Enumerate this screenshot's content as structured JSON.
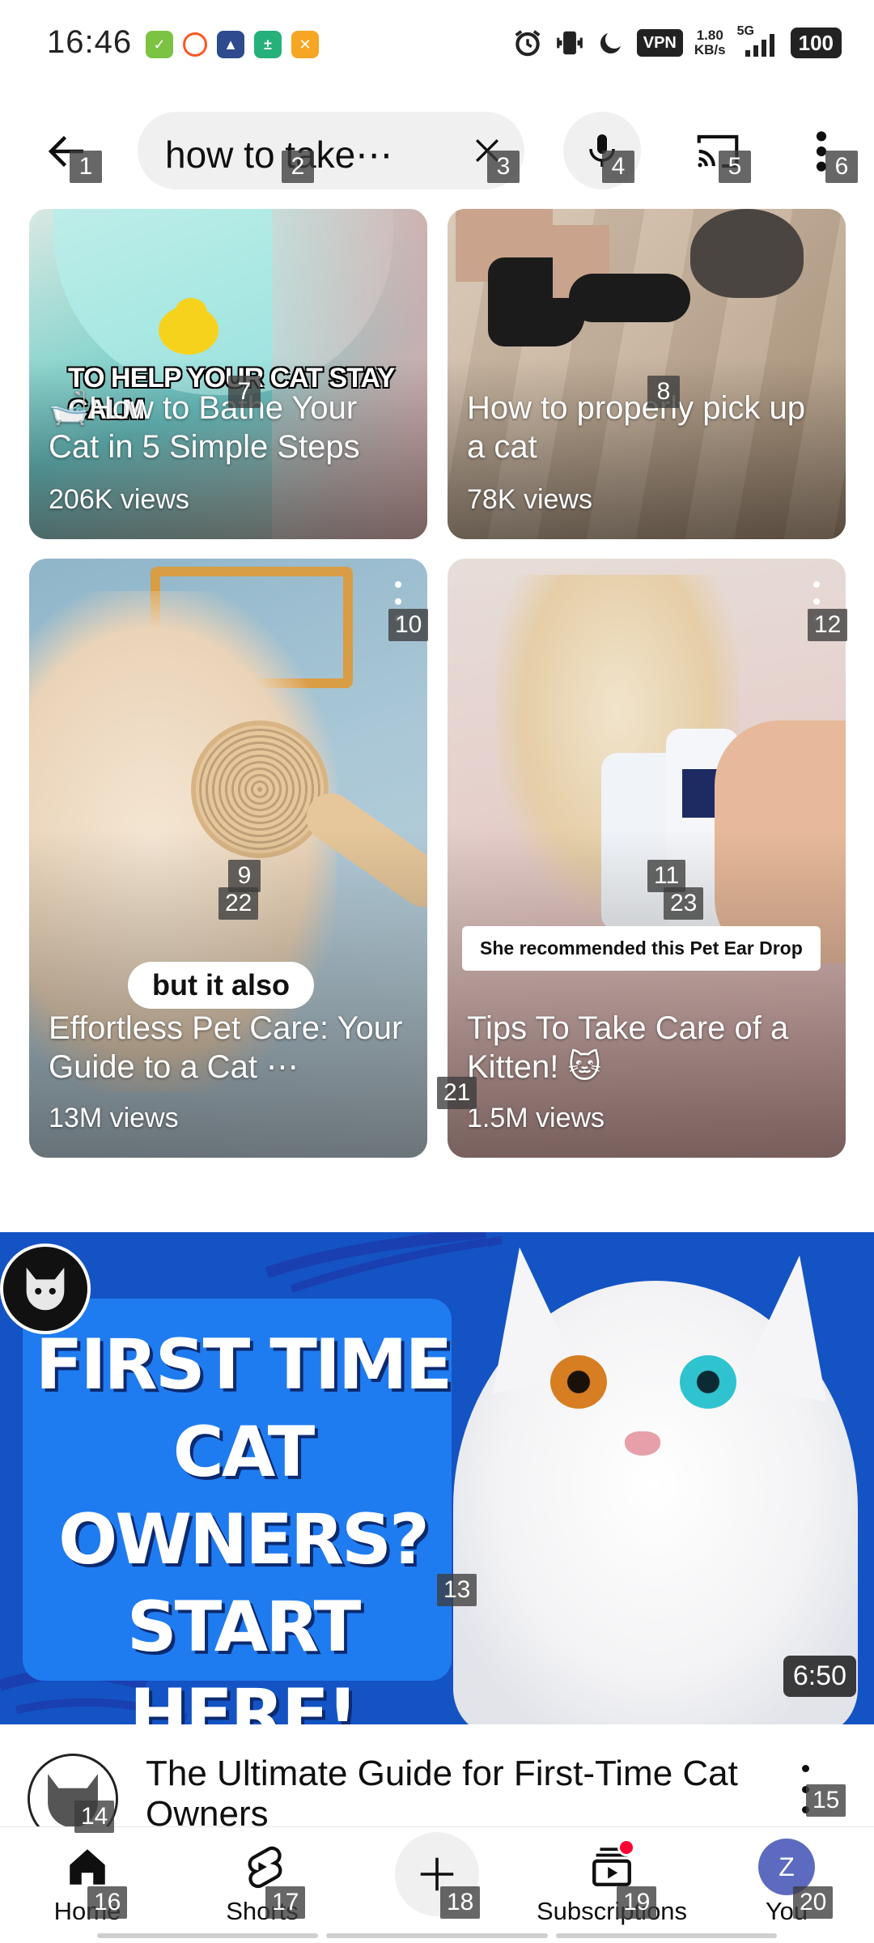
{
  "status_bar": {
    "time": "16:46",
    "vpn_label": "VPN",
    "net_speed_value": "1.80",
    "net_speed_unit": "KB/s",
    "network": "5G",
    "battery": "100"
  },
  "search": {
    "query": "how to take⋯"
  },
  "shorts": [
    {
      "caption_overlay": "TO HELP YOUR CAT STAY CALM",
      "title": "🛁How to Bathe Your Cat in 5 Simple Steps",
      "views": "206K views"
    },
    {
      "title": "How to properly pick up a cat",
      "views": "78K views"
    },
    {
      "caption_pill": "but it also",
      "title": "Effortless Pet Care: Your Guide to a Cat ⋯",
      "views": "13M views"
    },
    {
      "caption_box": "She recommended this Pet Ear Drop",
      "title": "Tips To Take Care of a Kitten! 🐱",
      "views": "1.5M views"
    }
  ],
  "video": {
    "thumbnail_text": [
      "FIRST TIME",
      "CAT",
      "OWNERS?",
      "START HERE!"
    ],
    "duration": "6:50",
    "title": "The Ultimate Guide for First-Time Cat Owners"
  },
  "bottom_nav": {
    "home": "Home",
    "shorts": "Shorts",
    "subscriptions": "Subscriptions",
    "you": "You",
    "you_initial": "Z"
  },
  "markers": [
    "1",
    "2",
    "3",
    "4",
    "5",
    "6",
    "7",
    "8",
    "9",
    "10",
    "11",
    "12",
    "13",
    "14",
    "15",
    "16",
    "17",
    "18",
    "19",
    "20",
    "21",
    "22",
    "23"
  ]
}
